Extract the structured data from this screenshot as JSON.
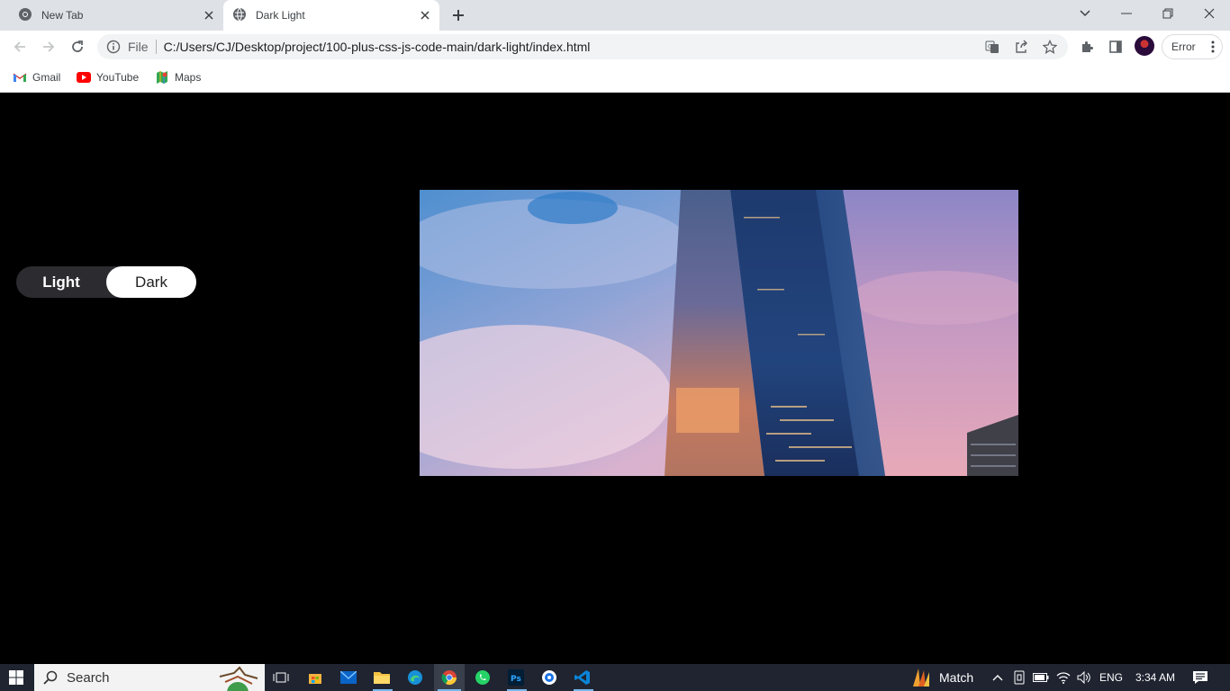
{
  "browser": {
    "tabs": [
      {
        "title": "New Tab",
        "active": false
      },
      {
        "title": "Dark Light",
        "active": true
      }
    ],
    "omnibox": {
      "scheme_label": "File",
      "url": "C:/Users/CJ/Desktop/project/100-plus-css-js-code-main/dark-light/index.html"
    },
    "profile_error_label": "Error",
    "bookmarks": [
      {
        "label": "Gmail",
        "icon": "gmail-icon"
      },
      {
        "label": "YouTube",
        "icon": "youtube-icon"
      },
      {
        "label": "Maps",
        "icon": "maps-icon"
      }
    ]
  },
  "page": {
    "toggle": {
      "light_label": "Light",
      "dark_label": "Dark",
      "selected": "Dark"
    },
    "photo": {
      "subject": "skyscraper-at-sunset"
    }
  },
  "taskbar": {
    "search_placeholder": "Search",
    "weather_label": "Match",
    "language": "ENG",
    "time": "3:34 AM"
  }
}
